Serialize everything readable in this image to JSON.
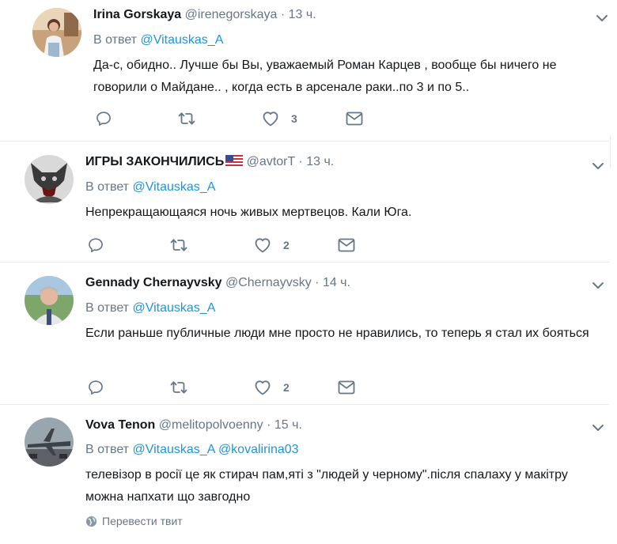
{
  "tweets": [
    {
      "name": "Irina Gorskaya",
      "handle": "@irenegorskaya",
      "dot": "·",
      "time": "13 ч.",
      "reply_prefix": "В ответ",
      "reply_to": [
        "@Vitauskas_A"
      ],
      "text": "Да-с, обидно.. Лучше бы Вы, уважаемый Роман Карцев , вообще бы ничего не говорили о Майдане.. , когда есть в арсенале раки..по 3 и по 5..",
      "likes": "3"
    },
    {
      "name": "ИГРЫ ЗАКОНЧИЛИСЬ",
      "handle": "@avtorT",
      "dot": "·",
      "time": "13 ч.",
      "reply_prefix": "В ответ",
      "reply_to": [
        "@Vitauskas_A"
      ],
      "text": "Непрекращающаяся ночь живых мертвецов. Кали Юга.",
      "likes": "2"
    },
    {
      "name": "Gennady Chernayvsky",
      "handle": "@Chernayvsky",
      "dot": "·",
      "time": "14 ч.",
      "reply_prefix": "В ответ",
      "reply_to": [
        "@Vitauskas_A"
      ],
      "text": "Если раньше публичные люди мне просто не нравились, то теперь я стал их бояться",
      "likes": "2"
    },
    {
      "name": "Vova Tenon",
      "handle": "@melitopolvoenny",
      "dot": "·",
      "time": "15 ч.",
      "reply_prefix": "В ответ",
      "reply_to": [
        "@Vitauskas_A",
        "@kovalirina03"
      ],
      "text": "телевізор в росії це як стирач пам,яті з \"людей у черному\".після спалаху у макітру можна напхати що завгодно",
      "translate": "Перевести твит"
    }
  ],
  "icons": {
    "reply": "reply-icon",
    "retweet": "retweet-icon",
    "like": "heart-icon",
    "dm": "envelope-icon",
    "more": "chevron-down-icon",
    "translate": "globe-icon",
    "flag": "us-flag-icon"
  },
  "colors": {
    "link": "#1b95e0",
    "muted": "#657786",
    "text": "#14171a",
    "divider": "#e6ecf0"
  }
}
